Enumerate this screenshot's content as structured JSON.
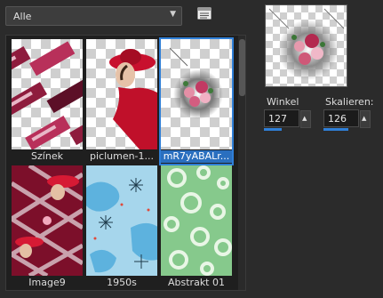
{
  "filter": {
    "selected": "Alle"
  },
  "tiles": [
    {
      "caption": "Színek"
    },
    {
      "caption": "piclumen-1..."
    },
    {
      "caption": "mR7yABALr..."
    },
    {
      "caption": "Image9"
    },
    {
      "caption": "1950s"
    },
    {
      "caption": "Abstrakt 01"
    }
  ],
  "controls": {
    "winkel": {
      "label": "Winkel",
      "value": "127",
      "progress": 0.35
    },
    "skalieren": {
      "label": "Skalieren:",
      "value": "126",
      "progress": 0.63
    }
  },
  "colors": {
    "accent": "#2f7fd7",
    "background": "#2b2b2b"
  }
}
